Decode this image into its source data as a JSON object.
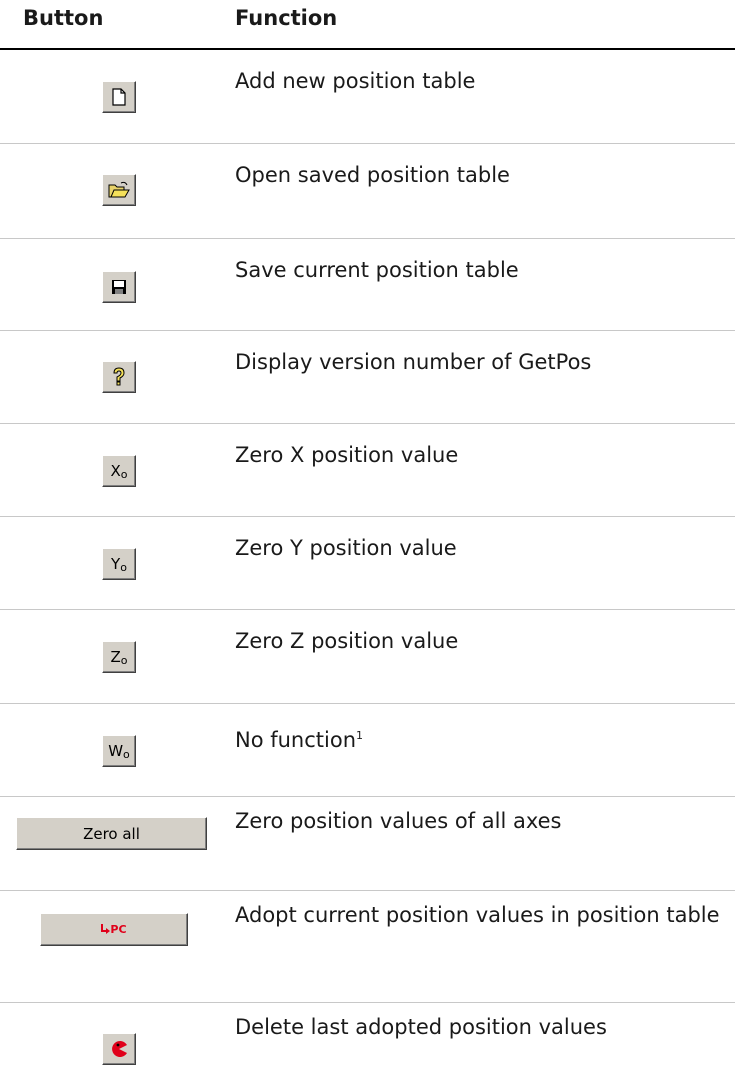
{
  "header": {
    "button_col": "Button",
    "function_col": "Function"
  },
  "rows": [
    {
      "icon": "new-document-icon",
      "button_text": "",
      "function": "Add new position table"
    },
    {
      "icon": "open-folder-icon",
      "button_text": "",
      "function": "Open saved position table"
    },
    {
      "icon": "save-disk-icon",
      "button_text": "",
      "function": "Save current position table"
    },
    {
      "icon": "question-mark-icon",
      "button_text": "",
      "function": "Display version number of GetPos"
    },
    {
      "icon": "",
      "button_text": "X",
      "button_sub": "o",
      "function": "Zero X position value"
    },
    {
      "icon": "",
      "button_text": "Y",
      "button_sub": "o",
      "function": "Zero Y position value"
    },
    {
      "icon": "",
      "button_text": "Z",
      "button_sub": "o",
      "function": "Zero Z position value"
    },
    {
      "icon": "",
      "button_text": "W",
      "button_sub": "o",
      "function": "No function",
      "footnote": "1"
    },
    {
      "icon": "",
      "button_text": "Zero all",
      "function": "Zero position values of all axes"
    },
    {
      "icon": "arrow-pc-icon",
      "button_text": "PC",
      "function": "Adopt current position values in position table"
    },
    {
      "icon": "delete-pacman-icon",
      "button_text": "",
      "function": "Delete last adopted position values"
    }
  ],
  "colors": {
    "button_face": "#d4d0c8",
    "accent_red": "#e0001a",
    "yellow": "#f5e15a"
  }
}
